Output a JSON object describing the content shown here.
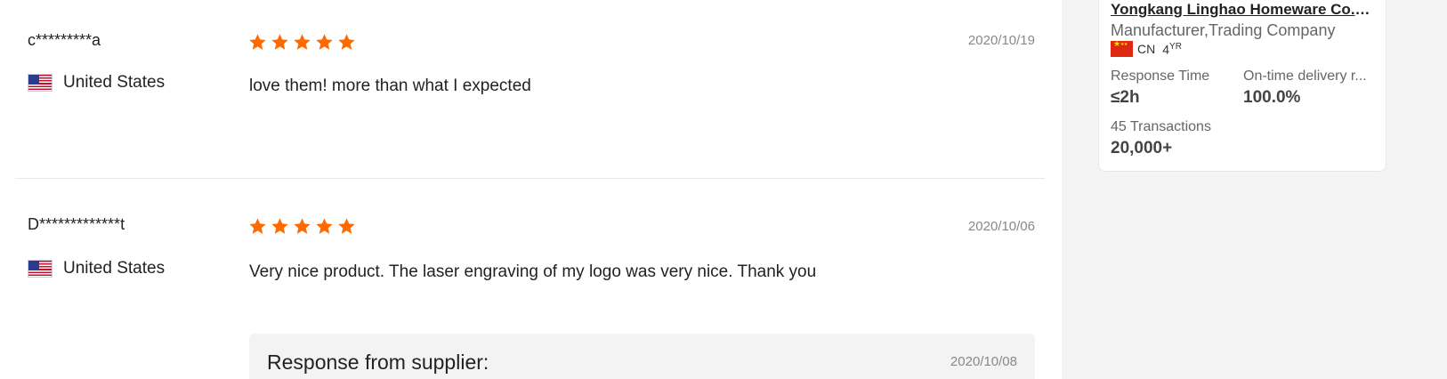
{
  "reviews": [
    {
      "user": "c*********a",
      "country": "United States",
      "rating": 5,
      "date": "2020/10/19",
      "comment": "love them! more than what I expected"
    },
    {
      "user": "D*************t",
      "country": "United States",
      "rating": 5,
      "date": "2020/10/06",
      "comment": "Very nice product. The laser engraving of my logo was very nice. Thank you",
      "response_title": "Response from supplier:",
      "response_date": "2020/10/08"
    }
  ],
  "supplier": {
    "name": "Yongkang Linghao Homeware Co., ...",
    "type": "Manufacturer,Trading Company",
    "country_code": "CN",
    "years": "4",
    "years_unit": "YR",
    "response_time_label": "Response Time",
    "response_time_value": "≤2h",
    "ontime_label": "On-time delivery r...",
    "ontime_value": "100.0%",
    "transactions_label": "45 Transactions",
    "transactions_value": "20,000+"
  },
  "colors": {
    "star": "#ff6a00"
  }
}
